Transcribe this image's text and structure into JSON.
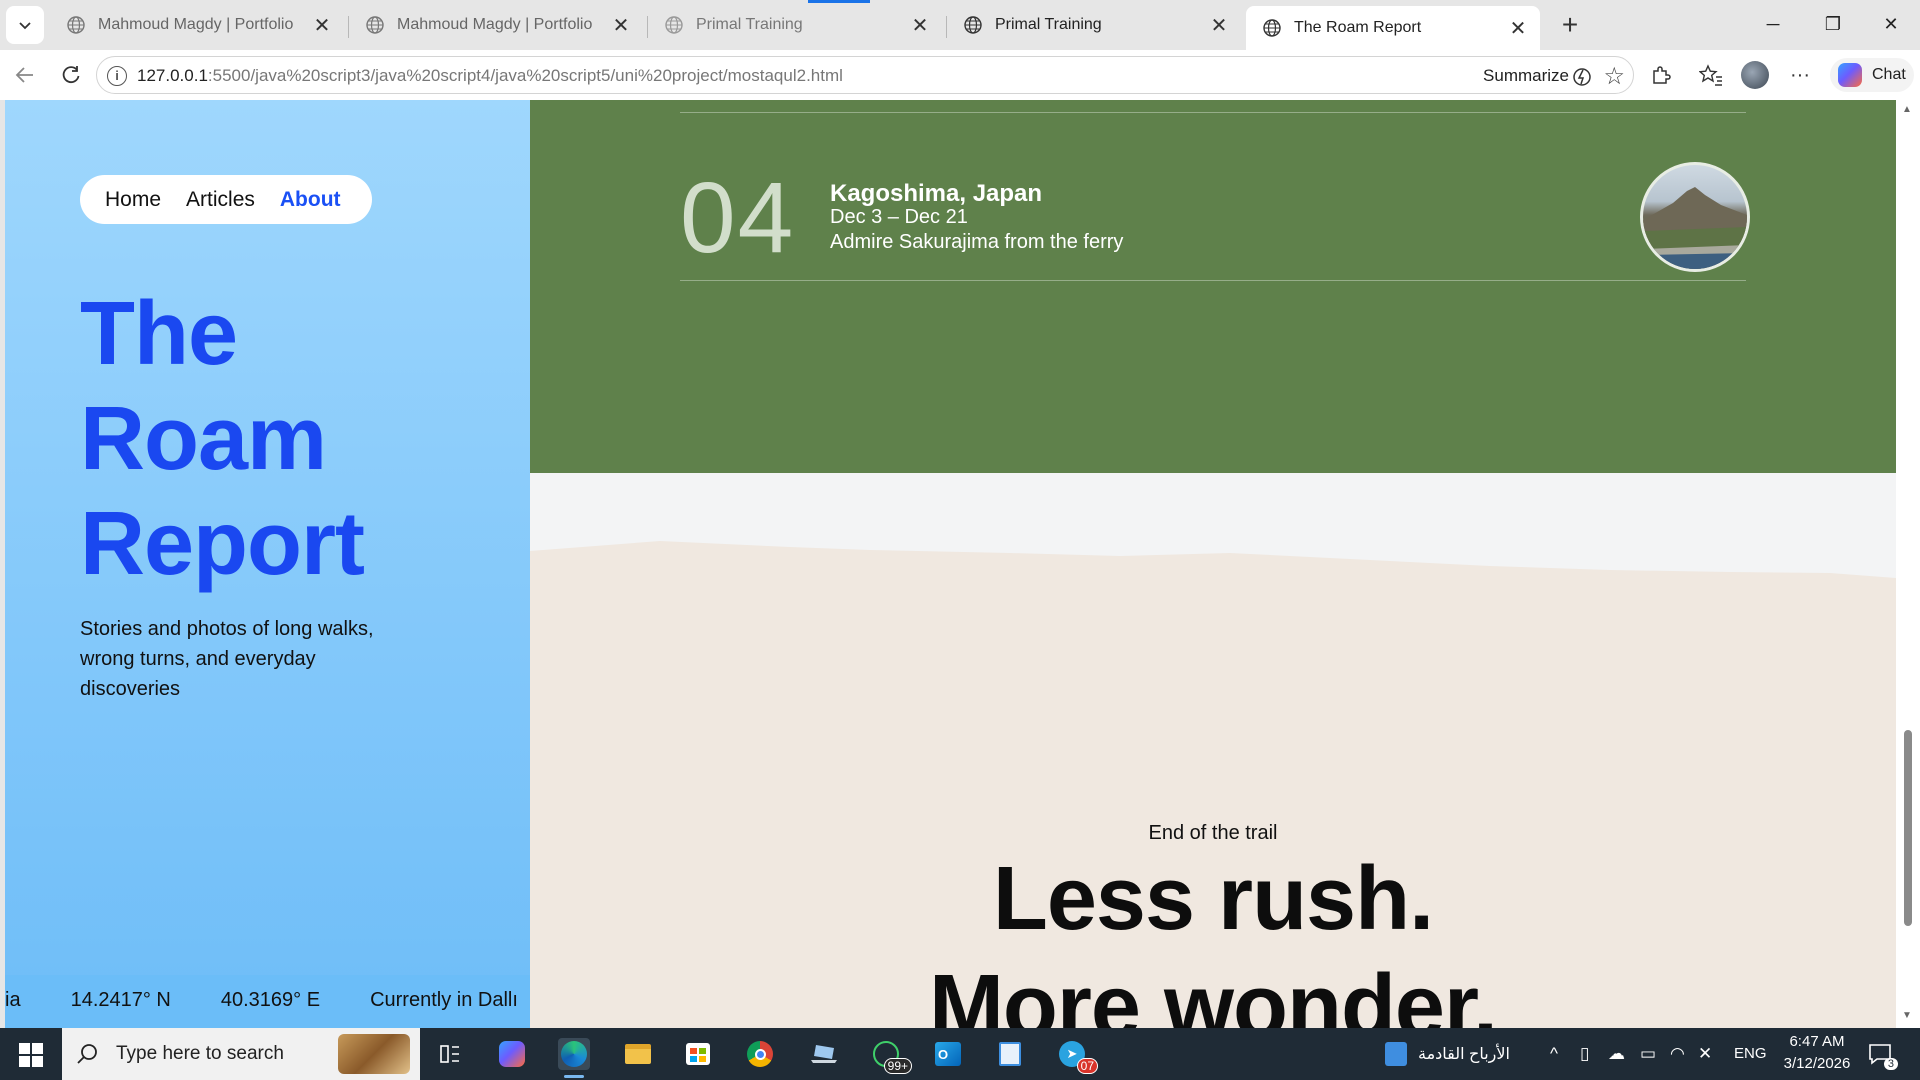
{
  "browser": {
    "tabs": [
      {
        "title": "Mahmoud Magdy | Portfolio",
        "close": "✕",
        "active": false
      },
      {
        "title": "Mahmoud Magdy | Portfolio",
        "close": "✕",
        "active": false
      },
      {
        "title": "Primal Training",
        "close": "✕",
        "active": false
      },
      {
        "title": "Primal Training",
        "close": "✕",
        "active": false
      },
      {
        "title": "The Roam Report",
        "close": "✕",
        "active": true
      }
    ],
    "new_tab": "+",
    "url_host": "127.0.0.1",
    "url_rest": ":5500/java%20script3/java%20script4/java%20script5/uni%20project/mostaqul2.html",
    "summarize_label": "Summarize",
    "chat_label": "Chat",
    "window_controls": {
      "minimize": "─",
      "restore": "❐",
      "close": "✕"
    }
  },
  "page": {
    "nav": {
      "home": "Home",
      "articles": "Articles",
      "about": "About"
    },
    "hero_title": [
      "The",
      "Roam",
      "Report"
    ],
    "hero_subtitle": "Stories and photos of long walks, wrong turns, and everyday discoveries",
    "ticker": [
      "ia",
      "14.2417° N",
      "40.3169° E",
      "Currently in Dallı"
    ],
    "trip": {
      "number": "04",
      "place": "Kagoshima, Japan",
      "dates": "Dec 3 – Dec 21",
      "note": "Admire Sakurajima from the ferry"
    },
    "end": {
      "eyebrow": "End of the trail",
      "line1": "Less rush.",
      "line2": "More wonder."
    }
  },
  "taskbar": {
    "search_placeholder": "Type here to search",
    "whatsapp_badge": "99+",
    "telegram_badge": "07",
    "news_label": "الأرباح القادمة",
    "language": "ENG",
    "time": "6:47 AM",
    "date": "3/12/2026",
    "notification_count": "3"
  },
  "colors": {
    "sidebar_top": "#9fd7fd",
    "sidebar_bottom": "#6ebdf8",
    "title_blue": "#1a48f0",
    "green_band": "#5f814b",
    "sand": "#f0e8e0"
  }
}
